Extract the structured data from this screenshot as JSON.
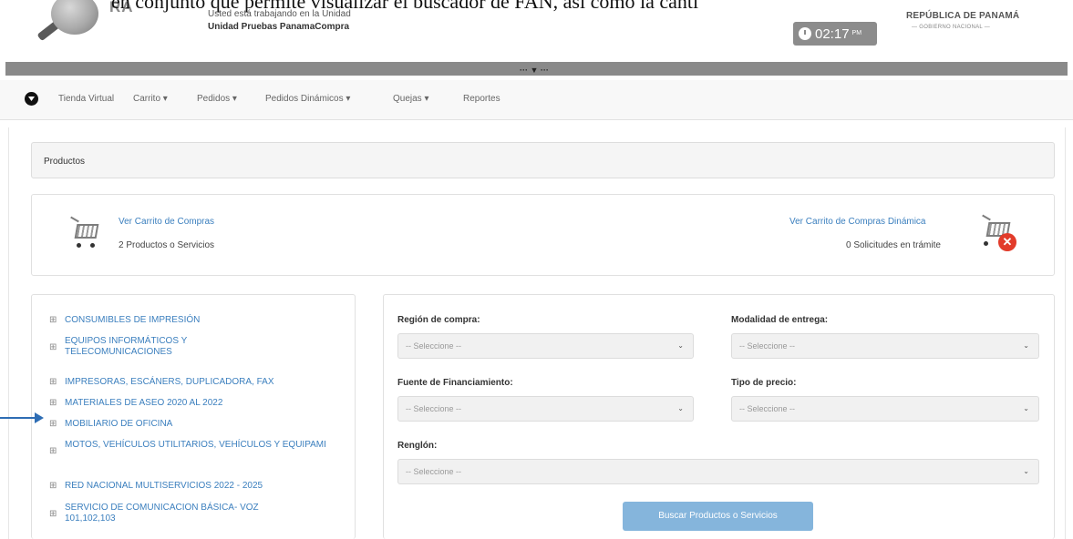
{
  "header": {
    "overflow_text": "en conjunto que permite visualizar el buscador de FAN, así como la canti",
    "logo_text": "RA",
    "unit_label": "Usted está trabajando en la Unidad",
    "unit_name": "Unidad Pruebas PanamaCompra",
    "timer_time": "02:17",
    "timer_ampm": "PM",
    "republica": "REPÚBLICA DE PANAMÁ",
    "gobierno": "— GOBIERNO NACIONAL —",
    "band_toggle": "··· ▼ ···"
  },
  "nav": {
    "items": [
      {
        "label": "Tienda Virtual"
      },
      {
        "label": "Carrito ▾"
      },
      {
        "label": "Pedidos ▾"
      },
      {
        "label": "Pedidos Dinámicos ▾"
      },
      {
        "label": "Quejas ▾"
      },
      {
        "label": "Reportes"
      }
    ]
  },
  "panel": {
    "title": "Productos"
  },
  "cart": {
    "left_link": "Ver Carrito de Compras",
    "left_count": "2 Productos o Servicios",
    "right_link": "Ver Carrito de Compras Dinámica",
    "right_count": "0 Solicitudes en trámite",
    "remove_symbol": "✕"
  },
  "categories": {
    "expand_symbol": "⊞",
    "items": [
      {
        "label": "CONSUMIBLES DE IMPRESIÓN"
      },
      {
        "label": "EQUIPOS INFORMÁTICOS Y TELECOMUNICACIONES"
      },
      {
        "label": "IMPRESORAS, ESCÁNERS, DUPLICADORA, FAX"
      },
      {
        "label": "MATERIALES DE ASEO 2020 AL 2022"
      },
      {
        "label": "MOBILIARIO DE OFICINA"
      },
      {
        "label": "MOTOS, VEHÍCULOS UTILITARIOS, VEHÍCULOS Y EQUIPAMI"
      },
      {
        "label": "RED NACIONAL MULTISERVICIOS 2022 - 2025"
      },
      {
        "label": "SERVICIO DE COMUNICACION BÁSICA- VOZ 101,102,103"
      }
    ]
  },
  "filters": {
    "region_label": "Región de compra:",
    "region_value": "-- Seleccione --",
    "modalidad_label": "Modalidad de entrega:",
    "modalidad_value": "-- Seleccione --",
    "fuente_label": "Fuente de Financiamiento:",
    "fuente_value": "-- Seleccione --",
    "tipo_label": "Tipo de precio:",
    "tipo_value": "-- Seleccione --",
    "renglon_label": "Renglón:",
    "renglon_value": "-- Seleccione --",
    "chevron": "⌄",
    "search_button": "Buscar Productos o Servicios"
  },
  "colors": {
    "link": "#3b7fbe",
    "button": "#85b5dc",
    "annotation_arrow": "#2e6db4",
    "cancel_badge": "#e23b2a"
  }
}
